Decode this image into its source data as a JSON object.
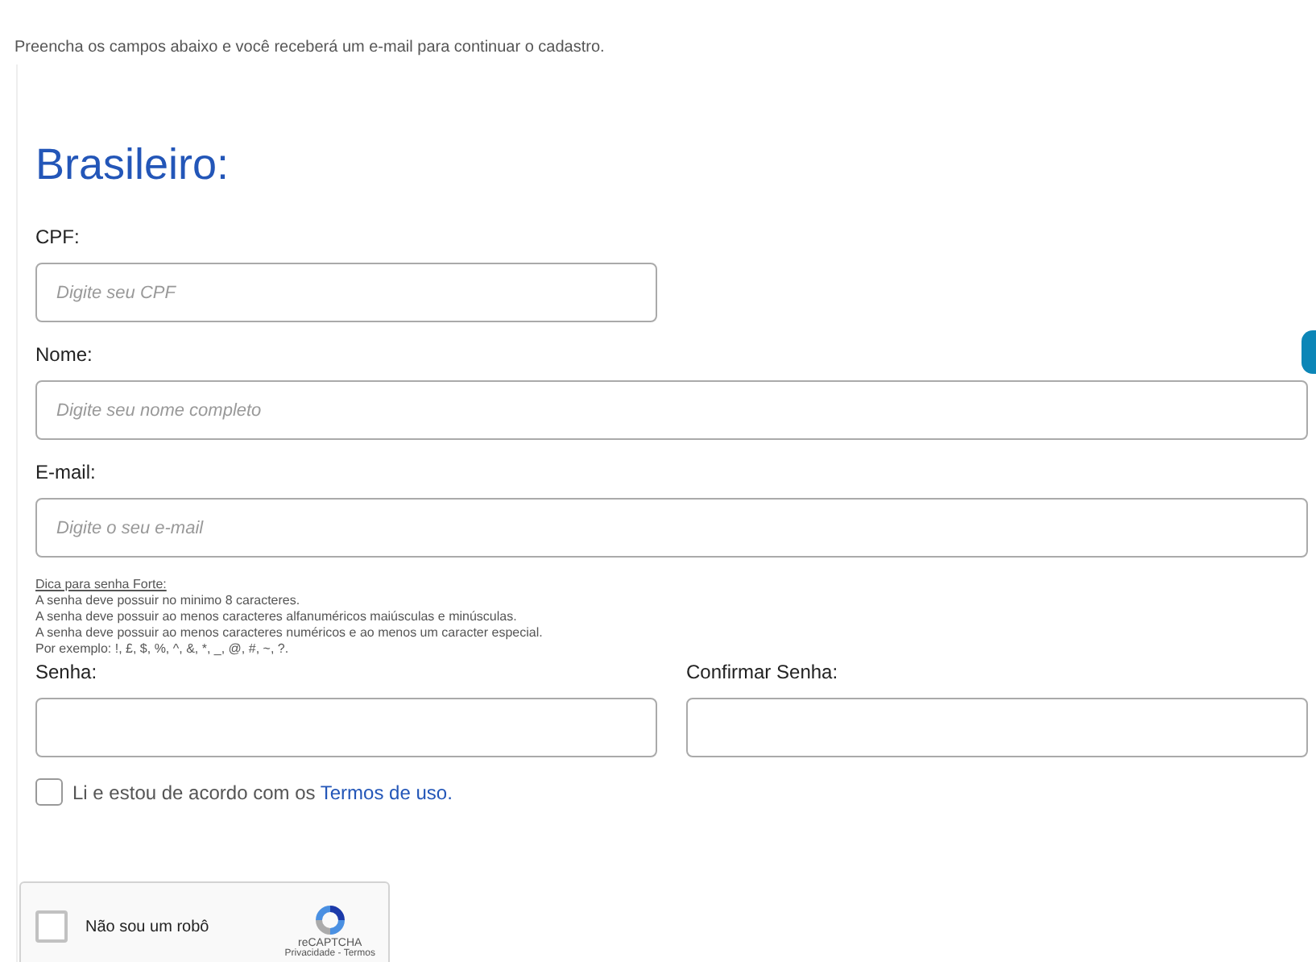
{
  "intro": "Preencha os campos abaixo e você receberá um e-mail para continuar o cadastro.",
  "heading": "Brasileiro:",
  "fields": [
    {
      "label": "CPF:",
      "placeholder": "Digite seu CPF"
    },
    {
      "label": "Nome:",
      "placeholder": "Digite seu nome completo"
    },
    {
      "label": "E-mail:",
      "placeholder": "Digite o seu e-mail"
    }
  ],
  "tips": {
    "title": "Dica para senha Forte:",
    "lines": [
      "A senha deve possuir no minimo 8 caracteres.",
      "A senha deve possuir ao menos caracteres alfanuméricos maiúsculas e minúsculas.",
      "A senha deve possuir ao menos caracteres numéricos e ao menos um caracter especial.",
      "Por exemplo: !, £, $, %, ^, &, *, _, @, #, ~, ?."
    ]
  },
  "password_fields": [
    {
      "label": "Senha:"
    },
    {
      "label": "Confirmar Senha:"
    }
  ],
  "terms": {
    "checked": false,
    "text": "Li e estou de acordo com os ",
    "link": "Termos de uso."
  },
  "captcha": {
    "checked": false,
    "label": "Não sou um robô",
    "brand": "reCAPTCHA",
    "links": "Privacidade - Termos"
  }
}
